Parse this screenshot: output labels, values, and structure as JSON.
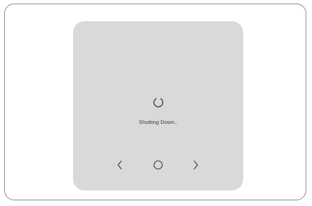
{
  "screen": {
    "status_text": "Shutting Down.."
  },
  "icons": {
    "spinner": "loading-spinner-icon",
    "previous": "chevron-left-icon",
    "home": "circle-home-icon",
    "next": "chevron-right-icon"
  },
  "colors": {
    "frame_border": "#8d8d8d",
    "screen_background": "#d9d9d9",
    "icon": "#4a4a4a",
    "text": "#3a3a3a"
  }
}
